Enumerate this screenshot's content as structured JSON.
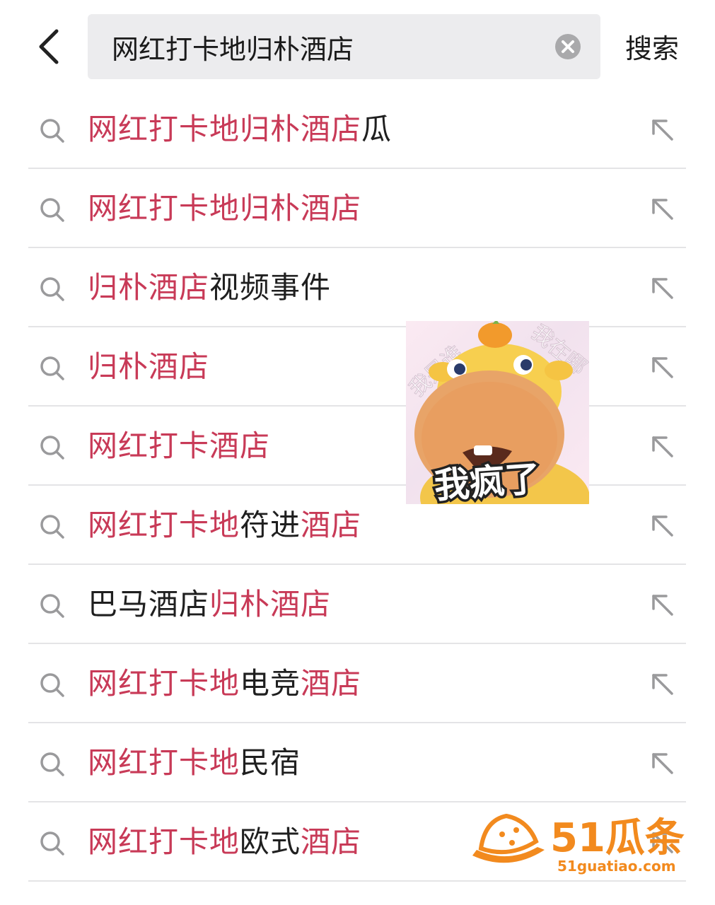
{
  "header": {
    "query": "网红打卡地归朴酒店",
    "search_label": "搜索",
    "icons": {
      "back": "chevron-left-icon",
      "clear": "clear-icon"
    }
  },
  "suggestions": [
    {
      "parts": [
        {
          "t": "网红打卡地归朴酒店",
          "hl": true
        },
        {
          "t": "瓜",
          "hl": false
        }
      ]
    },
    {
      "parts": [
        {
          "t": "网红打卡地归朴酒店",
          "hl": true
        }
      ]
    },
    {
      "parts": [
        {
          "t": "归朴酒店",
          "hl": true
        },
        {
          "t": "视频事件",
          "hl": false
        }
      ]
    },
    {
      "parts": [
        {
          "t": "归朴酒店",
          "hl": true
        }
      ]
    },
    {
      "parts": [
        {
          "t": "网红打卡酒店",
          "hl": true
        }
      ]
    },
    {
      "parts": [
        {
          "t": "网红打卡地",
          "hl": true
        },
        {
          "t": "符进",
          "hl": false
        },
        {
          "t": "酒店",
          "hl": true
        }
      ]
    },
    {
      "parts": [
        {
          "t": "巴马酒店",
          "hl": false
        },
        {
          "t": "归朴酒店",
          "hl": true
        }
      ]
    },
    {
      "parts": [
        {
          "t": "网红打卡地",
          "hl": true
        },
        {
          "t": "电竞",
          "hl": false
        },
        {
          "t": "酒店",
          "hl": true
        }
      ]
    },
    {
      "parts": [
        {
          "t": "网红打卡地",
          "hl": true
        },
        {
          "t": "民宿",
          "hl": false
        }
      ]
    },
    {
      "parts": [
        {
          "t": "网红打卡地",
          "hl": true
        },
        {
          "t": "欧式",
          "hl": false
        },
        {
          "t": "酒店",
          "hl": true
        }
      ]
    }
  ],
  "sticker": {
    "caption": "我疯了",
    "bg_text_left": "我是谁",
    "bg_text_right": "我在哪"
  },
  "watermark": {
    "brand": "51瓜条",
    "url": "51guatiao.com"
  },
  "colors": {
    "highlight": "#c83a57",
    "text": "#1f1f1f",
    "divider": "#e4e4e6",
    "search_bg": "#ececee",
    "watermark": "#f28a1e"
  }
}
